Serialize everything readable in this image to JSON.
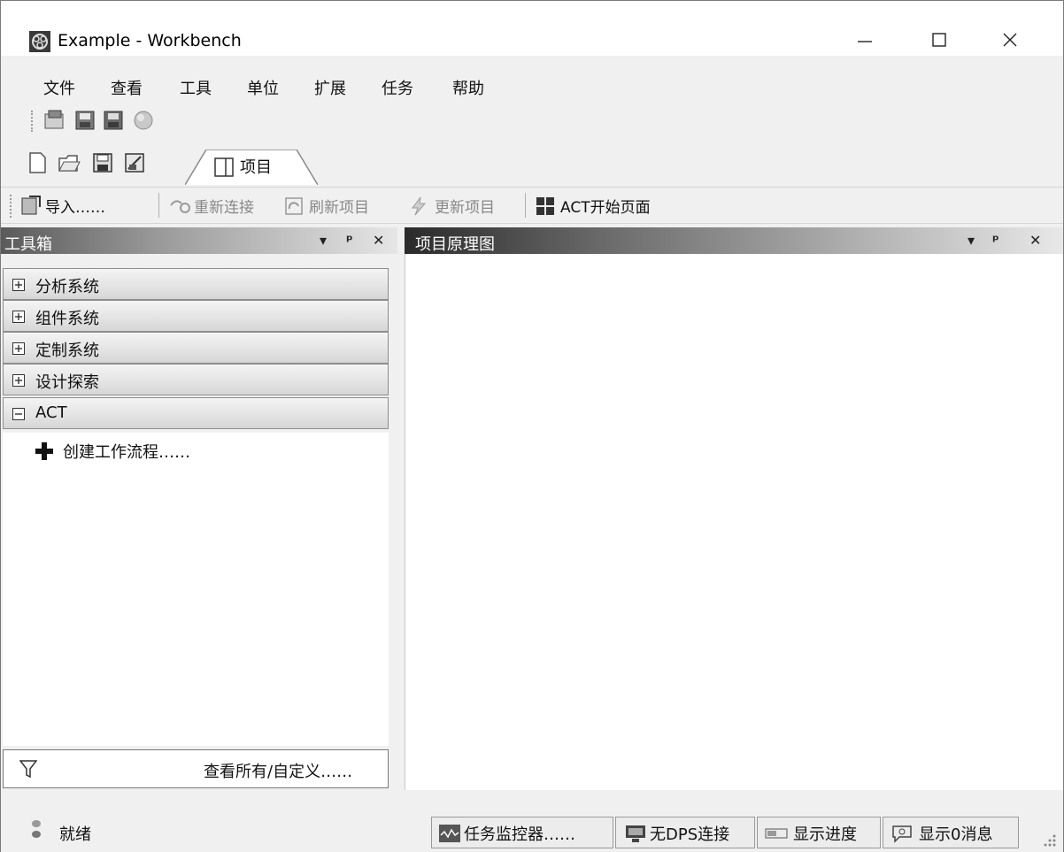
{
  "window": {
    "title": "Example - Workbench",
    "controls": {
      "minimize": "—",
      "maximize": "☐",
      "close": "✕"
    }
  },
  "menu": {
    "items": [
      "文件",
      "查看",
      "工具",
      "单位",
      "扩展",
      "任务",
      "帮助"
    ]
  },
  "toolbar_tab": {
    "label": "项目"
  },
  "action_bar": {
    "import": "导入……",
    "reconnect": "重新连接",
    "refresh": "刷新项目",
    "update": "更新项目",
    "act_start": "ACT开始页面"
  },
  "toolbox": {
    "title": "工具箱",
    "groups": [
      {
        "label": "分析系统",
        "state": "collapsed"
      },
      {
        "label": "组件系统",
        "state": "collapsed"
      },
      {
        "label": "定制系统",
        "state": "collapsed"
      },
      {
        "label": "设计探索",
        "state": "collapsed"
      },
      {
        "label": "ACT",
        "state": "expanded"
      }
    ],
    "act_items": [
      "创建工作流程……"
    ],
    "footer_link": "查看所有/自定义……"
  },
  "schematic": {
    "title": "项目原理图"
  },
  "panel_controls": {
    "dropdown": "▾",
    "pin": "ᵖ",
    "close": "✕"
  },
  "status": {
    "text": "就绪",
    "buttons": [
      "任务监控器……",
      "无DPS连接",
      "显示进度",
      "显示0消息"
    ]
  },
  "icons": {
    "app": "workbench-logo-icon",
    "expand": "plus-box-icon",
    "collapse": "minus-box-icon",
    "add": "plus-icon",
    "filter": "funnel-icon"
  }
}
